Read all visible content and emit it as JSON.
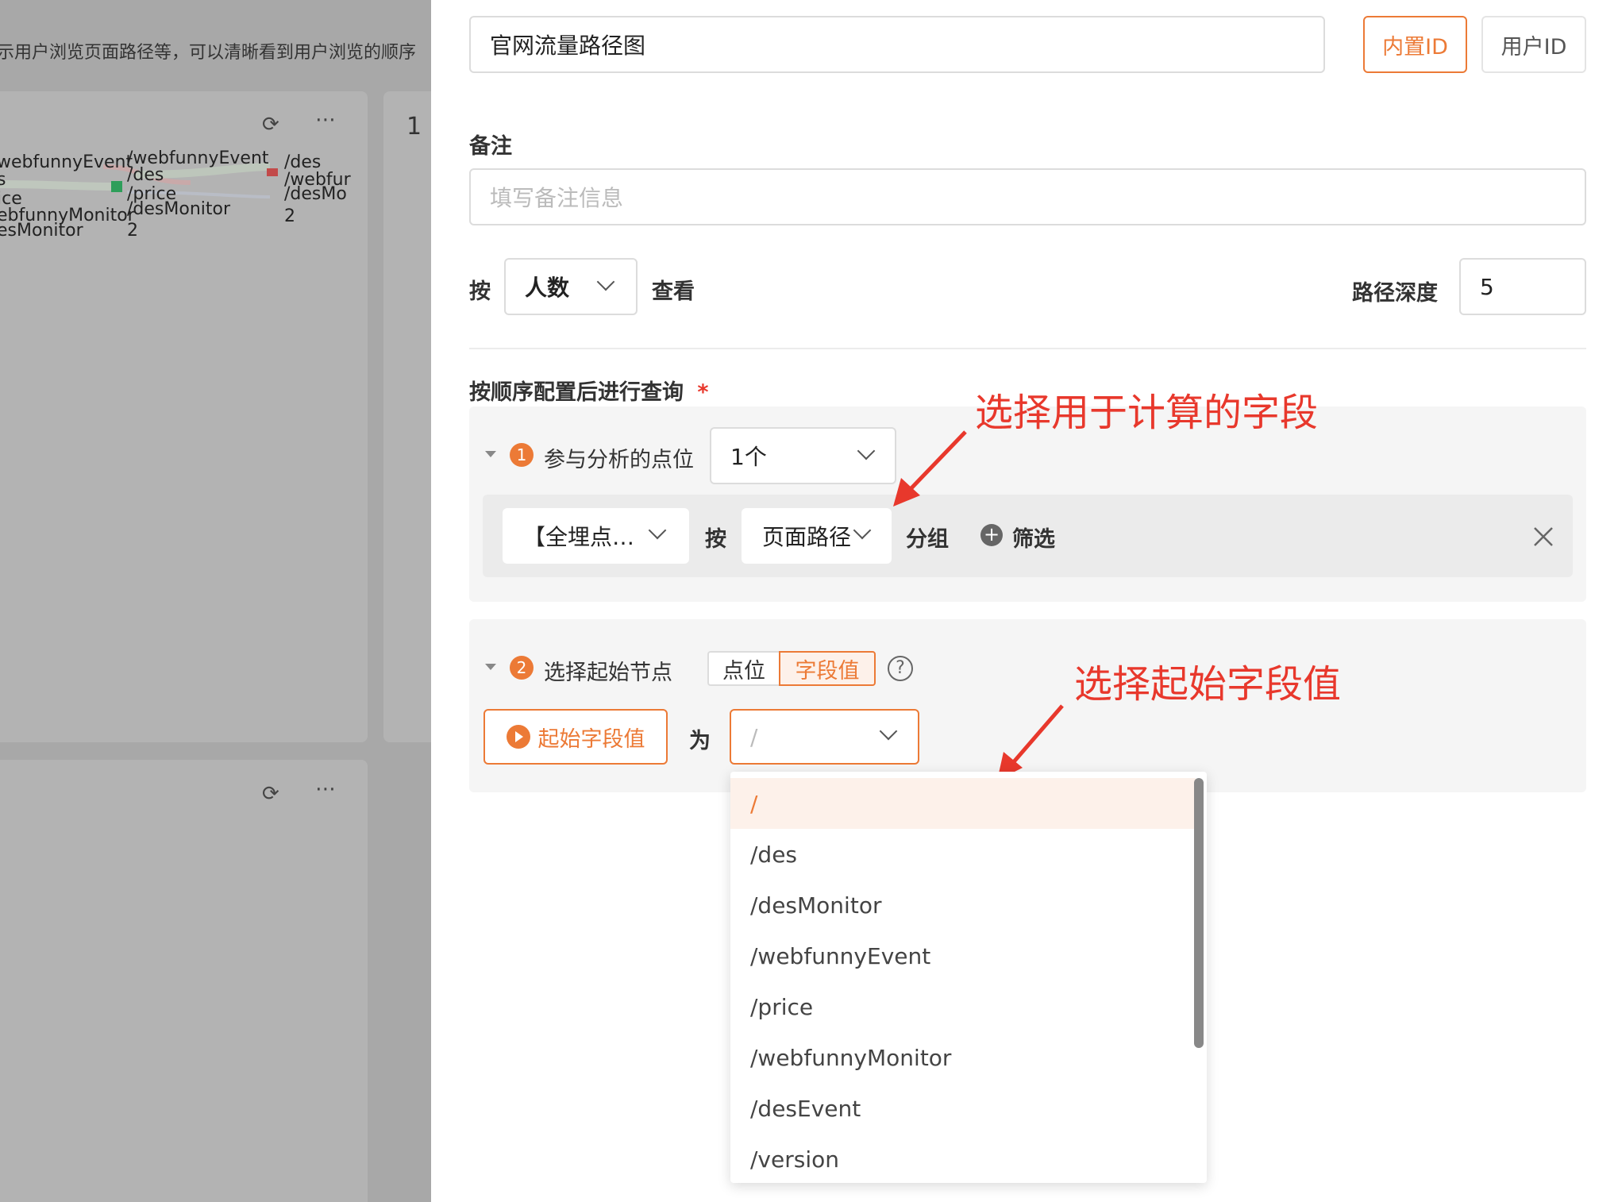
{
  "background": {
    "description": "示用户浏览页面路径等，可以清晰看到用户浏览的顺序",
    "card_number": "1",
    "sankey_nodes": [
      "webfunnyEvent",
      "s",
      "ice",
      "ebfunnyMonitor",
      "esMonitor",
      "/webfunnyEvent",
      "/des",
      "/price",
      "/desMonitor",
      "2",
      "/des",
      "/webfur",
      "/desMo",
      "2"
    ]
  },
  "drawer": {
    "name_value": "官网流量路径图",
    "id_tabs": [
      "内置ID",
      "用户ID"
    ],
    "remark_label": "备注",
    "remark_placeholder": "填写备注信息",
    "by_label": "按",
    "metric_value": "人数",
    "view_label": "查看",
    "depth_label": "路径深度",
    "depth_value": "5",
    "query_label": "按顺序配置后进行查询",
    "required_mark": "*",
    "step1": {
      "badge": "1",
      "title": "参与分析的点位",
      "count_value": "1个",
      "event_value": "【全埋点…",
      "by_label": "按",
      "group_field": "页面路径",
      "group_label": "分组",
      "filter_label": "筛选"
    },
    "step2": {
      "badge": "2",
      "title": "选择起始节点",
      "toggle_options": [
        "点位",
        "字段值"
      ],
      "start_button": "起始字段值",
      "is_label": "为",
      "start_value": "/"
    },
    "dropdown_options": [
      "/",
      "/des",
      "/desMonitor",
      "/webfunnyEvent",
      "/price",
      "/webfunnyMonitor",
      "/desEvent",
      "/version"
    ]
  },
  "annotations": {
    "field_note": "选择用于计算的字段",
    "start_note": "选择起始字段值"
  },
  "colors": {
    "accent": "#ec7a36",
    "annotation": "#e8382c"
  }
}
